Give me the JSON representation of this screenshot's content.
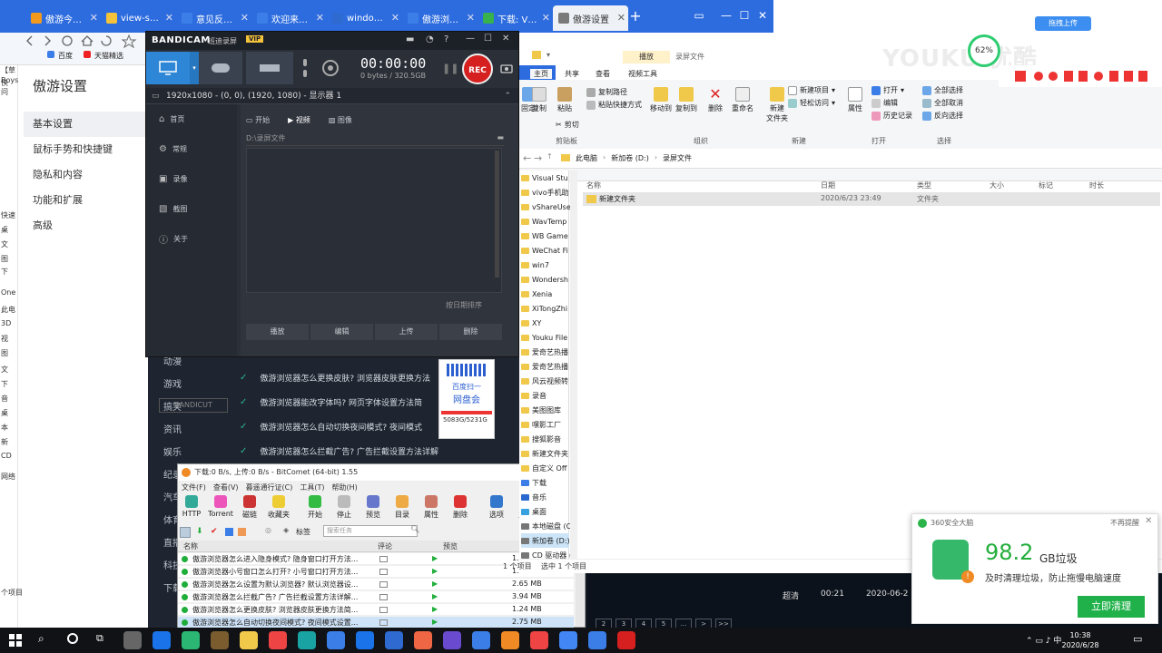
{
  "browser": {
    "tabs": [
      {
        "title": "傲游今日_傲游",
        "color": "#f39a1e",
        "active": false
      },
      {
        "title": "view-source",
        "color": "#f4c23b",
        "active": false
      },
      {
        "title": "意见反馈_问题",
        "color": "#3b7ee8",
        "active": false
      },
      {
        "title": "欢迎来到傲游",
        "color": "#3b7ee8",
        "active": false
      },
      {
        "title": "windows 10",
        "color": "#2f6ad0",
        "active": false
      },
      {
        "title": "傲游浏览器-",
        "color": "#3b7ee8",
        "active": false
      },
      {
        "title": "下载: V2luZi",
        "color": "#37b24d",
        "active": false
      },
      {
        "title": "傲游设置",
        "color": "#7a7a7a",
        "active": true
      }
    ],
    "bookmarks": [
      "百度",
      "天猫精选"
    ],
    "settings_title": "傲游设置",
    "settings_items": [
      "基本设置",
      "鼠标手势和快捷键",
      "隐私和内容",
      "功能和扩展",
      "高级"
    ],
    "left_strip": [
      "【草",
      "Boys",
      "快",
      "问",
      "快速",
      "桌",
      "文",
      "图",
      "下",
      "One",
      "此电",
      "3D",
      "视",
      "图",
      "文",
      "下",
      "音",
      "桌",
      "本",
      "新",
      "CD",
      "网络",
      "个项目"
    ],
    "dark_nav": [
      "动漫",
      "游戏",
      "搞笑",
      "资讯",
      "娱乐",
      "纪录",
      "汽车",
      "体育",
      "直播",
      "科技",
      "下载"
    ],
    "articles": [
      "傲游浏览器怎么更换皮肤? 浏览器皮肤更换方法",
      "傲游浏览器能改字体吗? 网页字体设置方法简",
      "傲游浏览器怎么自动切换夜间模式? 夜间模式",
      "傲游浏览器怎么拦截广告? 广告拦截设置方法详解"
    ],
    "baidu_ad": {
      "line1": "百度扫一",
      "line2": "网盘会",
      "size": "5083G/5231G"
    }
  },
  "bandicam": {
    "brand": "BANDICAM",
    "brand_accent": "CAM",
    "subtitle": "班迪录屏",
    "vip": "VIP",
    "timer": "00:00:00",
    "bytes": "0 bytes / 320.5GB",
    "rec_label": "REC",
    "resolution": "1920x1080 - (0, 0), (1920, 1080) - 显示器 1",
    "nav": [
      "首页",
      "常规",
      "录像",
      "截图",
      "关于"
    ],
    "tabs": [
      "开始",
      "视频",
      "图像"
    ],
    "path": "D:\\录屏文件",
    "sort": "按日期排序",
    "buttons": [
      "播放",
      "编辑",
      "上传",
      "删除"
    ],
    "bandicut": "BANDICUT"
  },
  "bitcomet": {
    "title": "下载:0 B/s, 上传:0 B/s - BitComet (64-bit) 1.55",
    "menu": [
      "文件(F)",
      "查看(V)",
      "暮遥通行证(C)",
      "工具(T)",
      "帮助(H)"
    ],
    "toolbar": [
      "HTTP",
      "Torrent",
      "磁链",
      "收藏夹",
      "开始",
      "停止",
      "预览",
      "目录",
      "属性",
      "删除",
      "选项",
      "主页",
      "影视"
    ],
    "tag_label": "标签",
    "search_placeholder": "搜索任务",
    "columns": [
      "名称",
      "评论",
      "预览"
    ],
    "rows": [
      {
        "name": "傲游浏览器怎么进入隐身模式? 隐身窗口打开方法...",
        "size": "1.29 MB",
        "selected": false
      },
      {
        "name": "傲游浏览器小号窗口怎么打开? 小号窗口打开方法...",
        "size": "1.64 MB",
        "selected": false
      },
      {
        "name": "傲游浏览器怎么设置为默认浏览器? 默认浏览器设...",
        "size": "2.65 MB",
        "selected": false
      },
      {
        "name": "傲游浏览器怎么拦截广告? 广告拦截设置方法详解...",
        "size": "3.94 MB",
        "selected": false
      },
      {
        "name": "傲游浏览器怎么更换皮肤? 浏览器皮肤更换方法简...",
        "size": "1.24 MB",
        "selected": false
      },
      {
        "name": "傲游浏览器怎么自动切换夜间模式? 夜间模式设置...",
        "size": "2.75 MB",
        "selected": true
      }
    ]
  },
  "explorer": {
    "title": "录屏文件",
    "context_tab": "播放",
    "tabs": [
      "主页",
      "共享",
      "查看",
      "视频工具"
    ],
    "clipboard": {
      "group": "剪贴板",
      "pin": "固定到快速访问",
      "copy": "复制",
      "paste": "粘贴",
      "copy_path": "复制路径",
      "paste_shortcut": "粘贴快捷方式",
      "cut": "剪切"
    },
    "organize": {
      "group": "组织",
      "move_to": "移动到",
      "copy_to": "复制到",
      "delete": "删除",
      "rename": "重命名"
    },
    "new": {
      "group": "新建",
      "new_folder": "新建\n文件夹",
      "new_item": "新建项目",
      "easy_access": "轻松访问"
    },
    "open": {
      "group": "打开",
      "properties": "属性",
      "open": "打开",
      "edit": "编辑",
      "history": "历史记录"
    },
    "select": {
      "group": "选择",
      "select_all": "全部选择",
      "select_none": "全部取消",
      "invert": "反向选择"
    },
    "breadcrumb": [
      "此电脑",
      "新加卷 (D:)",
      "录屏文件"
    ],
    "tree": [
      "Visual Stu",
      "vivo手机助",
      "vShareUse",
      "WavTemp",
      "WB Game",
      "WeChat Fi",
      "win7",
      "Wondersh",
      "Xenia",
      "XiTongZhi",
      "XY",
      "Youku File",
      "爱奇艺热播",
      "爱奇艺热播",
      "风云视频转",
      "录音",
      "美图图库",
      "嘿影工厂",
      "搜狐影音",
      "新建文件夹",
      "自定义 Off",
      "下载",
      "音乐",
      "桌面",
      "本地磁盘 (C:",
      "新加卷 (D:)",
      "CD 驱动器 ("
    ],
    "columns": [
      "名称",
      "日期",
      "类型",
      "大小",
      "标记",
      "时长"
    ],
    "row": {
      "name": "新建文件夹",
      "date": "2020/6/23 23:49",
      "type": "文件夹"
    },
    "status": {
      "count": "1 个项目",
      "selected": "选中 1 个项目"
    }
  },
  "youku": {
    "logo": "YOUKU 优酷",
    "percent": "62%",
    "upload": "拖拽上传"
  },
  "panel360": {
    "title": "360安全大脑",
    "no_remind": "不再提醒",
    "big": "98.2",
    "unit": "GB垃圾",
    "desc": "及时清理垃圾，防止拖慢电脑速度",
    "button": "立即清理"
  },
  "video_row": {
    "quality": "超清",
    "duration": "00:21",
    "date": "2020-06-2"
  },
  "pager": [
    "2",
    "3",
    "4",
    "5",
    "...",
    ">",
    ">>"
  ],
  "clock": {
    "time": "10:38",
    "date": "2020/6/28"
  },
  "colors": {
    "accent": "#2d6cdf",
    "rec": "#d62020",
    "green": "#20b14a"
  }
}
